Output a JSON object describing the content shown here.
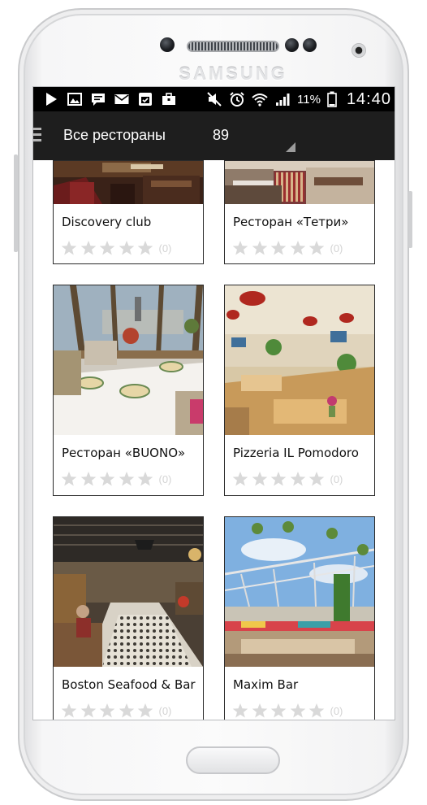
{
  "device": {
    "brand": "SAMSUNG"
  },
  "status_bar": {
    "left_icons": [
      "play-icon",
      "gallery-icon",
      "message-icon",
      "email-icon",
      "calendar-icon",
      "briefcase-icon"
    ],
    "right_icons": [
      "mute-icon",
      "alarm-icon",
      "wifi-icon",
      "signal-icon"
    ],
    "battery": "11%",
    "time": "14:40"
  },
  "action_bar": {
    "title": "Все рестораны",
    "count": "89"
  },
  "restaurants": [
    {
      "name": "Discovery club",
      "reviews": "(0)",
      "rating": 0
    },
    {
      "name": "Ресторан «Тетри»",
      "reviews": "(0)",
      "rating": 0
    },
    {
      "name": "Ресторан «BUONO»",
      "reviews": "(0)",
      "rating": 0
    },
    {
      "name": "Pizzeria IL Pomodoro",
      "reviews": "(0)",
      "rating": 0
    },
    {
      "name": "Boston Seafood & Bar",
      "reviews": "(0)",
      "rating": 0
    },
    {
      "name": "Maxim Bar",
      "reviews": "(0)",
      "rating": 0
    }
  ],
  "colors": {
    "action_bar": "#1e1e1e",
    "status_bar": "#000000",
    "star_empty": "#d9d9d9"
  }
}
